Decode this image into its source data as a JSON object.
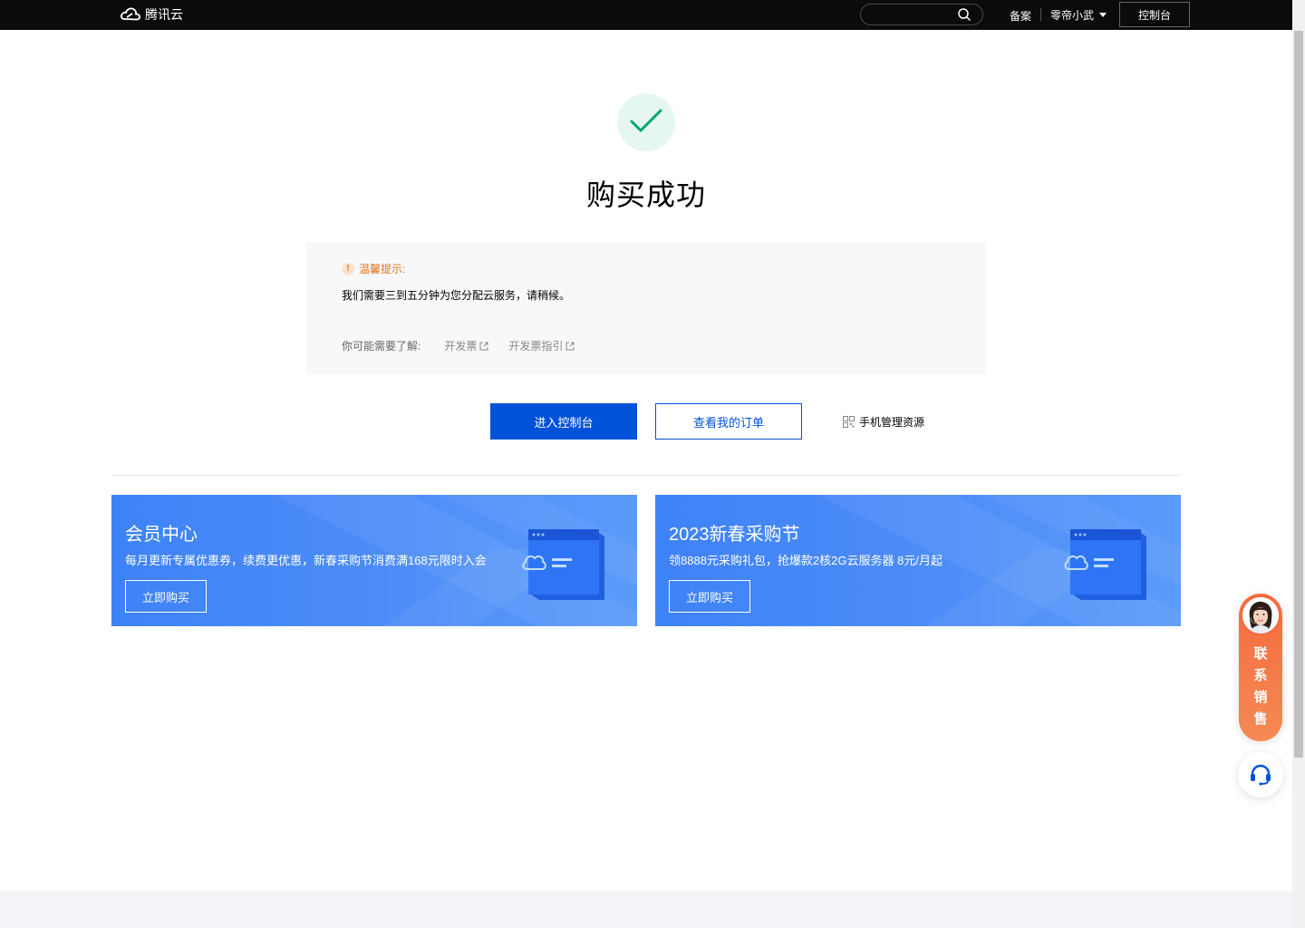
{
  "topbar": {
    "logo_text": "腾讯云",
    "search_placeholder": "",
    "beian": "备案",
    "user_name": "零帝小武",
    "console_button": "控制台"
  },
  "success": {
    "title": "购买成功"
  },
  "tip": {
    "heading": "温馨提示:",
    "body": "我们需要三到五分钟为您分配云服务，请稍候。",
    "links_label": "你可能需要了解:",
    "links": [
      "开发票",
      "开发票指引"
    ]
  },
  "actions": {
    "primary": "进入控制台",
    "secondary": "查看我的订单",
    "mobile": "手机管理资源"
  },
  "banners": [
    {
      "title": "会员中心",
      "desc": "每月更新专属优惠券，续费更优惠，新春采购节消费满168元限时入会",
      "button": "立即购买"
    },
    {
      "title": "2023新春采购节",
      "desc": "领8888元采购礼包，抢爆款2核2G云服务器 8元/月起",
      "button": "立即购买"
    }
  ],
  "floating": {
    "sales_chars": [
      "联",
      "系",
      "销",
      "售"
    ]
  },
  "colors": {
    "primary": "#0052d9",
    "success": "#00a870",
    "warning": "#e37318",
    "banner": "#4f8ff8"
  },
  "icons": [
    "tencent-cloud-logo-icon",
    "search-icon",
    "caret-down-icon",
    "check-icon",
    "warning-icon",
    "external-link-icon",
    "qrcode-icon",
    "headset-icon"
  ]
}
